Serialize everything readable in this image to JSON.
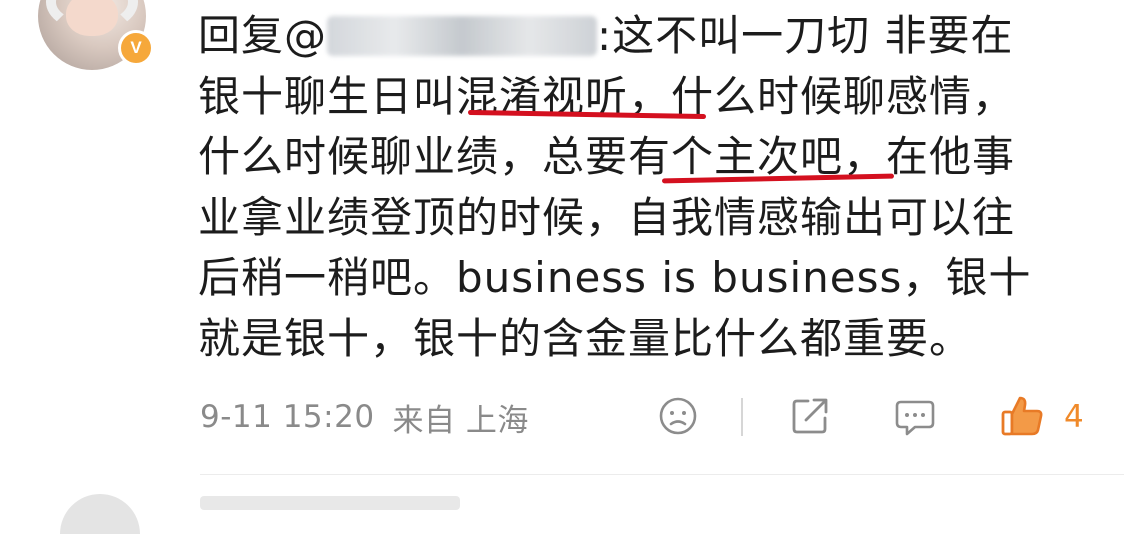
{
  "comment": {
    "reply_prefix": "回复@",
    "line1_rest": ":这不叫一刀切 非要在",
    "line2a": "银十聊生日叫",
    "line2_hl": "混淆视听，",
    "line2b": "什么时候聊感情，",
    "line3a": "什么时候聊业绩，总要",
    "line3_hl": "有个主次吧",
    "line3b": "，在他事",
    "line4": "业拿业绩登顶的时候，自我情感输出可以往",
    "line5": "后稍一稍吧。business is business，银十",
    "line6": "就是银十，银十的含金量比什么都重要。"
  },
  "meta": {
    "date": "9-11 15:20",
    "source": "来自 上海",
    "like_count": "4"
  },
  "badge": {
    "label": "V"
  },
  "colors": {
    "underline": "#d4101f",
    "like_accent": "#f08a2a",
    "meta_text": "#8a8a8a"
  },
  "icons": [
    "avatar",
    "verified-badge-icon",
    "emoji-icon",
    "share-icon",
    "comment-icon",
    "like-icon"
  ]
}
